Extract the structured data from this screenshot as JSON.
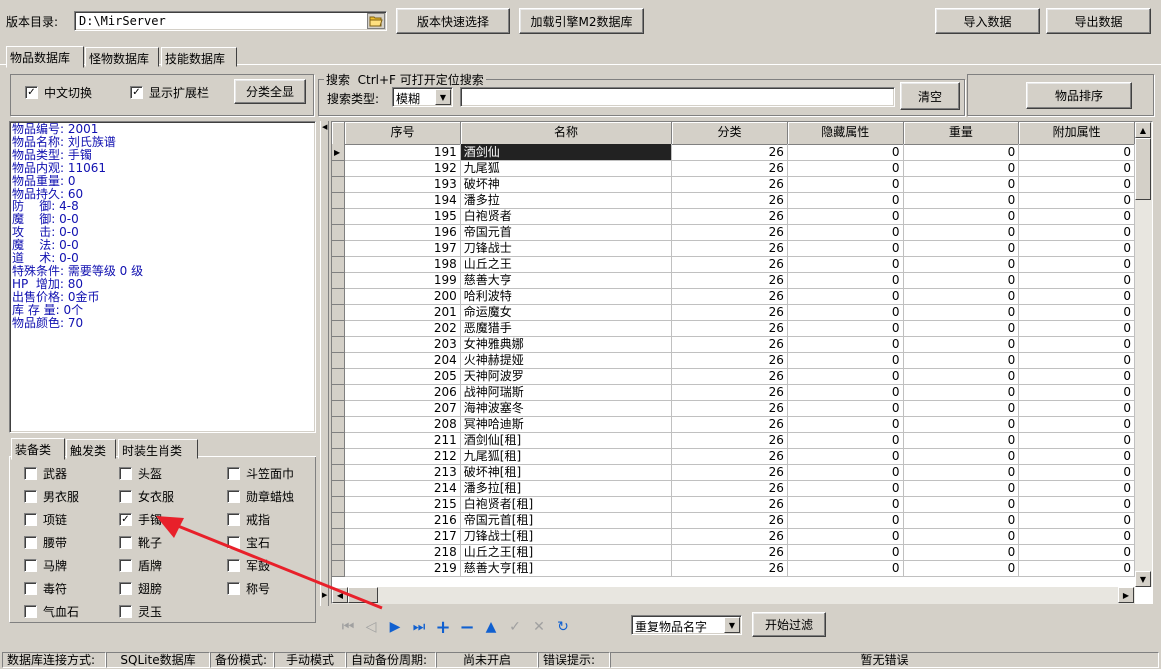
{
  "toolbar": {
    "dir_label": "版本目录:",
    "dir_value": "D:\\MirServer",
    "quick_select": "版本快速选择",
    "load_engine": "加载引擎M2数据库",
    "import": "导入数据",
    "export": "导出数据"
  },
  "main_tabs": [
    "物品数据库",
    "怪物数据库",
    "技能数据库"
  ],
  "options": {
    "chinese_toggle": "中文切换",
    "chinese_checked": true,
    "show_ext": "显示扩展栏",
    "show_ext_checked": true,
    "expand_all": "分类全显"
  },
  "search": {
    "legend": "搜索  Ctrl+F 可打开定位搜索",
    "type_label": "搜索类型:",
    "type_value": "模糊",
    "clear": "清空",
    "sort": "物品排序"
  },
  "info_lines": [
    "物品编号: 2001",
    "物品名称: 刘氏族谱",
    "物品类型: 手镯",
    "物品内观: 11061",
    "物品重量: 0",
    "物品持久: 60",
    "防    御: 4-8",
    "魔    御: 0-0",
    "攻    击: 0-0",
    "魔    法: 0-0",
    "道    术: 0-0",
    "特殊条件: 需要等级 0 级",
    "HP  增加: 80",
    "出售价格: 0金币",
    "库 存 量: 0个",
    "物品颜色: 70"
  ],
  "cat_tabs": [
    "装备类",
    "触发类",
    "时装生肖类"
  ],
  "categories": [
    {
      "label": "武器",
      "checked": false
    },
    {
      "label": "头盔",
      "checked": false
    },
    {
      "label": "斗笠面巾",
      "checked": false
    },
    {
      "label": "男衣服",
      "checked": false
    },
    {
      "label": "女衣服",
      "checked": false
    },
    {
      "label": "勋章蜡烛",
      "checked": false
    },
    {
      "label": "项链",
      "checked": false
    },
    {
      "label": "手镯",
      "checked": true
    },
    {
      "label": "戒指",
      "checked": false
    },
    {
      "label": "腰带",
      "checked": false
    },
    {
      "label": "靴子",
      "checked": false
    },
    {
      "label": "宝石",
      "checked": false
    },
    {
      "label": "马牌",
      "checked": false
    },
    {
      "label": "盾牌",
      "checked": false
    },
    {
      "label": "军鼓",
      "checked": false
    },
    {
      "label": "毒符",
      "checked": false
    },
    {
      "label": "翅膀",
      "checked": false
    },
    {
      "label": "称号",
      "checked": false
    },
    {
      "label": "气血石",
      "checked": false
    },
    {
      "label": "灵玉",
      "checked": false
    }
  ],
  "grid": {
    "columns": [
      "序号",
      "名称",
      "分类",
      "隐藏属性",
      "重量",
      "附加属性"
    ],
    "rows": [
      [
        "191",
        "酒剑仙",
        "26",
        "0",
        "0",
        "0"
      ],
      [
        "192",
        "九尾狐",
        "26",
        "0",
        "0",
        "0"
      ],
      [
        "193",
        "破坏神",
        "26",
        "0",
        "0",
        "0"
      ],
      [
        "194",
        "潘多拉",
        "26",
        "0",
        "0",
        "0"
      ],
      [
        "195",
        "白袍贤者",
        "26",
        "0",
        "0",
        "0"
      ],
      [
        "196",
        "帝国元首",
        "26",
        "0",
        "0",
        "0"
      ],
      [
        "197",
        "刀锋战士",
        "26",
        "0",
        "0",
        "0"
      ],
      [
        "198",
        "山丘之王",
        "26",
        "0",
        "0",
        "0"
      ],
      [
        "199",
        "慈善大亨",
        "26",
        "0",
        "0",
        "0"
      ],
      [
        "200",
        "哈利波特",
        "26",
        "0",
        "0",
        "0"
      ],
      [
        "201",
        "命运魔女",
        "26",
        "0",
        "0",
        "0"
      ],
      [
        "202",
        "恶魔猎手",
        "26",
        "0",
        "0",
        "0"
      ],
      [
        "203",
        "女神雅典娜",
        "26",
        "0",
        "0",
        "0"
      ],
      [
        "204",
        "火神赫提娅",
        "26",
        "0",
        "0",
        "0"
      ],
      [
        "205",
        "天神阿波罗",
        "26",
        "0",
        "0",
        "0"
      ],
      [
        "206",
        "战神阿瑞斯",
        "26",
        "0",
        "0",
        "0"
      ],
      [
        "207",
        "海神波塞冬",
        "26",
        "0",
        "0",
        "0"
      ],
      [
        "208",
        "冥神哈迪斯",
        "26",
        "0",
        "0",
        "0"
      ],
      [
        "211",
        "酒剑仙[租]",
        "26",
        "0",
        "0",
        "0"
      ],
      [
        "212",
        "九尾狐[租]",
        "26",
        "0",
        "0",
        "0"
      ],
      [
        "213",
        "破坏神[租]",
        "26",
        "0",
        "0",
        "0"
      ],
      [
        "214",
        "潘多拉[租]",
        "26",
        "0",
        "0",
        "0"
      ],
      [
        "215",
        "白袍贤者[租]",
        "26",
        "0",
        "0",
        "0"
      ],
      [
        "216",
        "帝国元首[租]",
        "26",
        "0",
        "0",
        "0"
      ],
      [
        "217",
        "刀锋战士[租]",
        "26",
        "0",
        "0",
        "0"
      ],
      [
        "218",
        "山丘之王[租]",
        "26",
        "0",
        "0",
        "0"
      ],
      [
        "219",
        "慈善大亨[租]",
        "26",
        "0",
        "0",
        "0"
      ]
    ]
  },
  "filter": {
    "value": "重复物品名字",
    "start": "开始过滤"
  },
  "status": {
    "conn_label": "数据库连接方式:",
    "conn_value": "SQLite数据库",
    "backup_label": "备份模式:",
    "backup_value": "手动模式",
    "auto_label": "自动备份周期:",
    "auto_value": "尚未开启",
    "err_label": "错误提示:",
    "err_value": "暂无错误"
  },
  "colors": {
    "info_text": "#1010b0",
    "arrow": "#e8202a",
    "selected_row": "#222222"
  }
}
